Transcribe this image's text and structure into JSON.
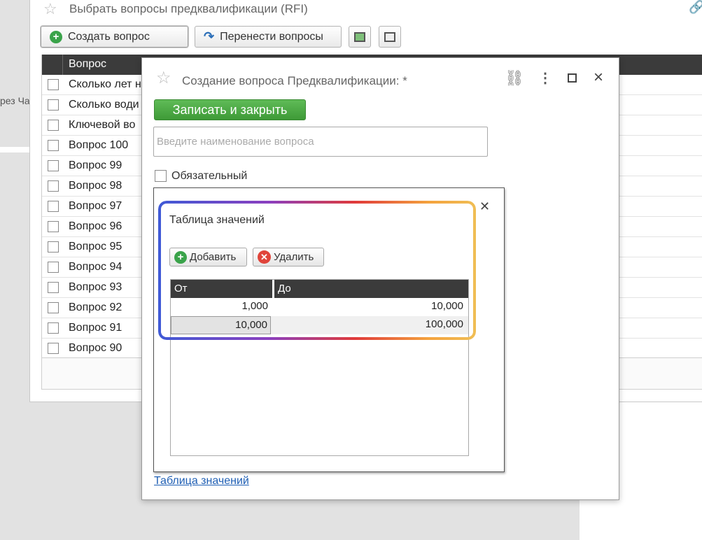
{
  "background_window": {
    "title": "Выбрать вопросы предквалификации (RFI)",
    "cut_off_text": "рез Ча",
    "toolbar": {
      "create_label": "Создать вопрос",
      "move_label": "Перенести вопросы"
    },
    "table": {
      "header": "Вопрос",
      "rows": [
        "Сколько лет н",
        "Сколько води",
        "Ключевой во",
        "Вопрос 100",
        "Вопрос 99",
        "Вопрос 98",
        "Вопрос 97",
        "Вопрос 96",
        "Вопрос 95",
        "Вопрос 94",
        "Вопрос 93",
        "Вопрос 92",
        "Вопрос 91",
        "Вопрос 90"
      ]
    }
  },
  "dialog": {
    "title": "Создание вопроса Предквалификации: *",
    "save_close_label": "Записать и закрыть",
    "name_placeholder": "Введите наименование вопроса",
    "required_label": "Обязательный",
    "values_link": "Таблица значений",
    "popup": {
      "title": "Таблица значений",
      "add_label": "Добавить",
      "delete_label": "Удалить",
      "columns": [
        "От",
        "До"
      ],
      "rows": [
        {
          "from": "1,000",
          "to": "10,000"
        },
        {
          "from": "10,000",
          "to": "100,000"
        }
      ]
    }
  },
  "colors": {
    "save_button": "#4caf50",
    "header_dark": "#3b3b3b",
    "link": "#1f5fb4",
    "highlight_gradient": [
      "#3f5ad6",
      "#8b3fbf",
      "#e03a3a",
      "#f4a23d"
    ]
  }
}
